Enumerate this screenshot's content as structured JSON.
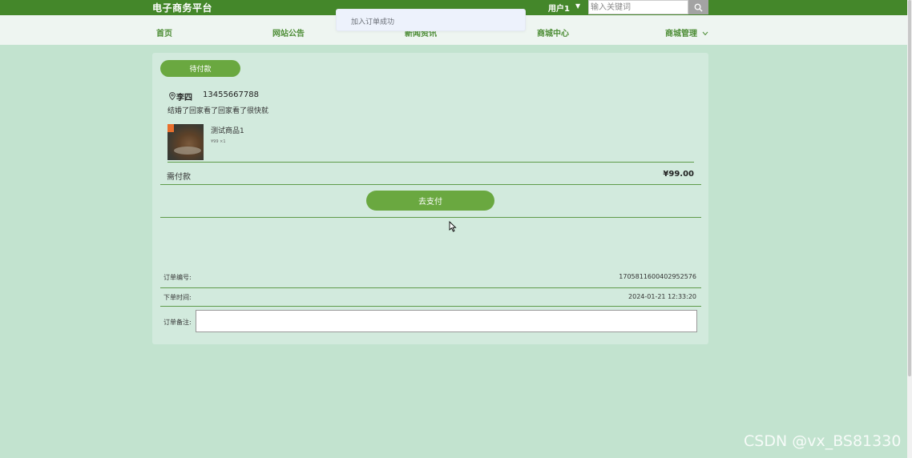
{
  "header": {
    "site_title": "电子商务平台",
    "user_label": "用户1",
    "search_placeholder": "输入关键词"
  },
  "nav": {
    "items": [
      {
        "label": "首页"
      },
      {
        "label": "网站公告"
      },
      {
        "label": "新闻资讯"
      },
      {
        "label": "商城中心"
      },
      {
        "label": "商城管理"
      }
    ]
  },
  "toast": {
    "message": "加入订单成功"
  },
  "order": {
    "status": "待付款",
    "recipient_name": "李四",
    "recipient_phone": "13455667788",
    "address": "结婚了回家看了回家看了很快就",
    "product": {
      "name": "测试商品1",
      "meta": "¥99 ×1"
    },
    "amount_label": "需付款",
    "amount": "¥99.00",
    "pay_button": "去支付",
    "order_no_label": "订单编号:",
    "order_no": "1705811600402952576",
    "order_time_label": "下单时间:",
    "order_time": "2024-01-21 12:33:20",
    "remark_label": "订单备注:"
  },
  "watermark": "CSDN @vx_BS81330",
  "colors": {
    "header_green": "#44872a",
    "accent_green": "#6aa840",
    "nav_text": "#4d8d36",
    "page_bg": "#c2e3cf"
  }
}
